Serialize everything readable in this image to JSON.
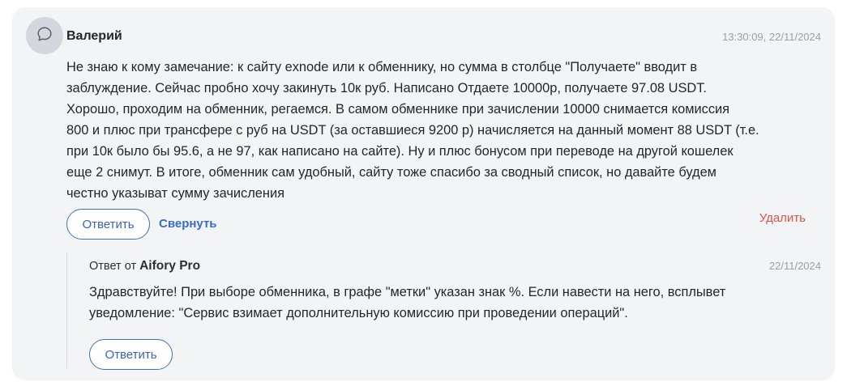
{
  "comment": {
    "author": "Валерий",
    "timestamp": "13:30:09, 22/11/2024",
    "avatar_icon": "chat-bubble-icon",
    "lines": [
      "Не знаю к кому замечание: к сайту exnode или к обменнику, но сумма в столбце \"Получаете\" вводит в",
      "заблуждение. Сейчас пробно хочу закинуть 10к руб. Написано Отдаете 10000р, получаете 97.08 USDT.",
      "Хорошо, проходим на обменник, регаемся. В самом обменнике при зачислении 10000 снимается комиссия",
      "800 и плюс при трансфере с руб на USDT (за оставшиеся 9200 р) начисляется на данный момент 88 USDT (т.е.",
      "при 10к было бы 95.6, а не 97, как написано на сайте). Ну и плюс бонусом при переводе на другой кошелек",
      "еще 2 снимут. В итоге, обменник сам удобный, сайту тоже спасибо за сводный список, но давайте будем",
      "честно указыват сумму зачисления"
    ],
    "reply_button": "Ответить",
    "collapse_link": "Свернуть",
    "delete_link": "Удалить"
  },
  "reply": {
    "prefix": "Ответ от",
    "author": "Aifory Pro",
    "date": "22/11/2024",
    "lines": [
      "Здравствуйте! При выборе обменника, в графе \"метки\" указан знак %. Если навести на него, всплывет",
      "уведомление: \"Сервис взимает дополнительную комиссию при проведении операций\"."
    ],
    "reply_button": "Ответить"
  },
  "colors": {
    "card_background": "#f3f4f6",
    "accent": "#3a6cc9",
    "danger": "#d9534f",
    "muted": "#9aa0a8"
  }
}
